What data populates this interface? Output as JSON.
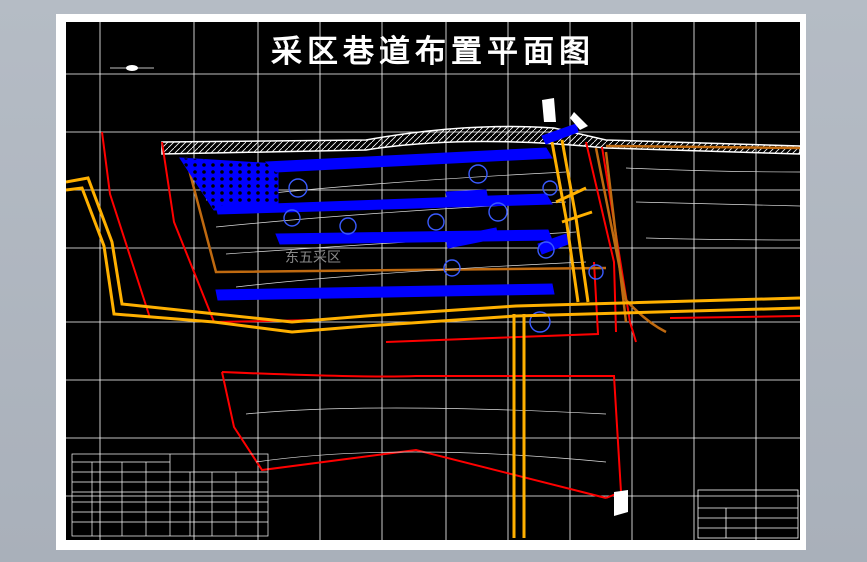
{
  "drawing": {
    "title": "采区巷道布置平面图",
    "area_label": "东五采区"
  },
  "colors": {
    "background": "#000000",
    "grid": "#ffffff",
    "haulage_roadway": "#ffb000",
    "mining_roadway": "#0000ff",
    "boundary": "#ff0000",
    "panel_outline": "#c06a10",
    "hatch": "#ffffff"
  }
}
